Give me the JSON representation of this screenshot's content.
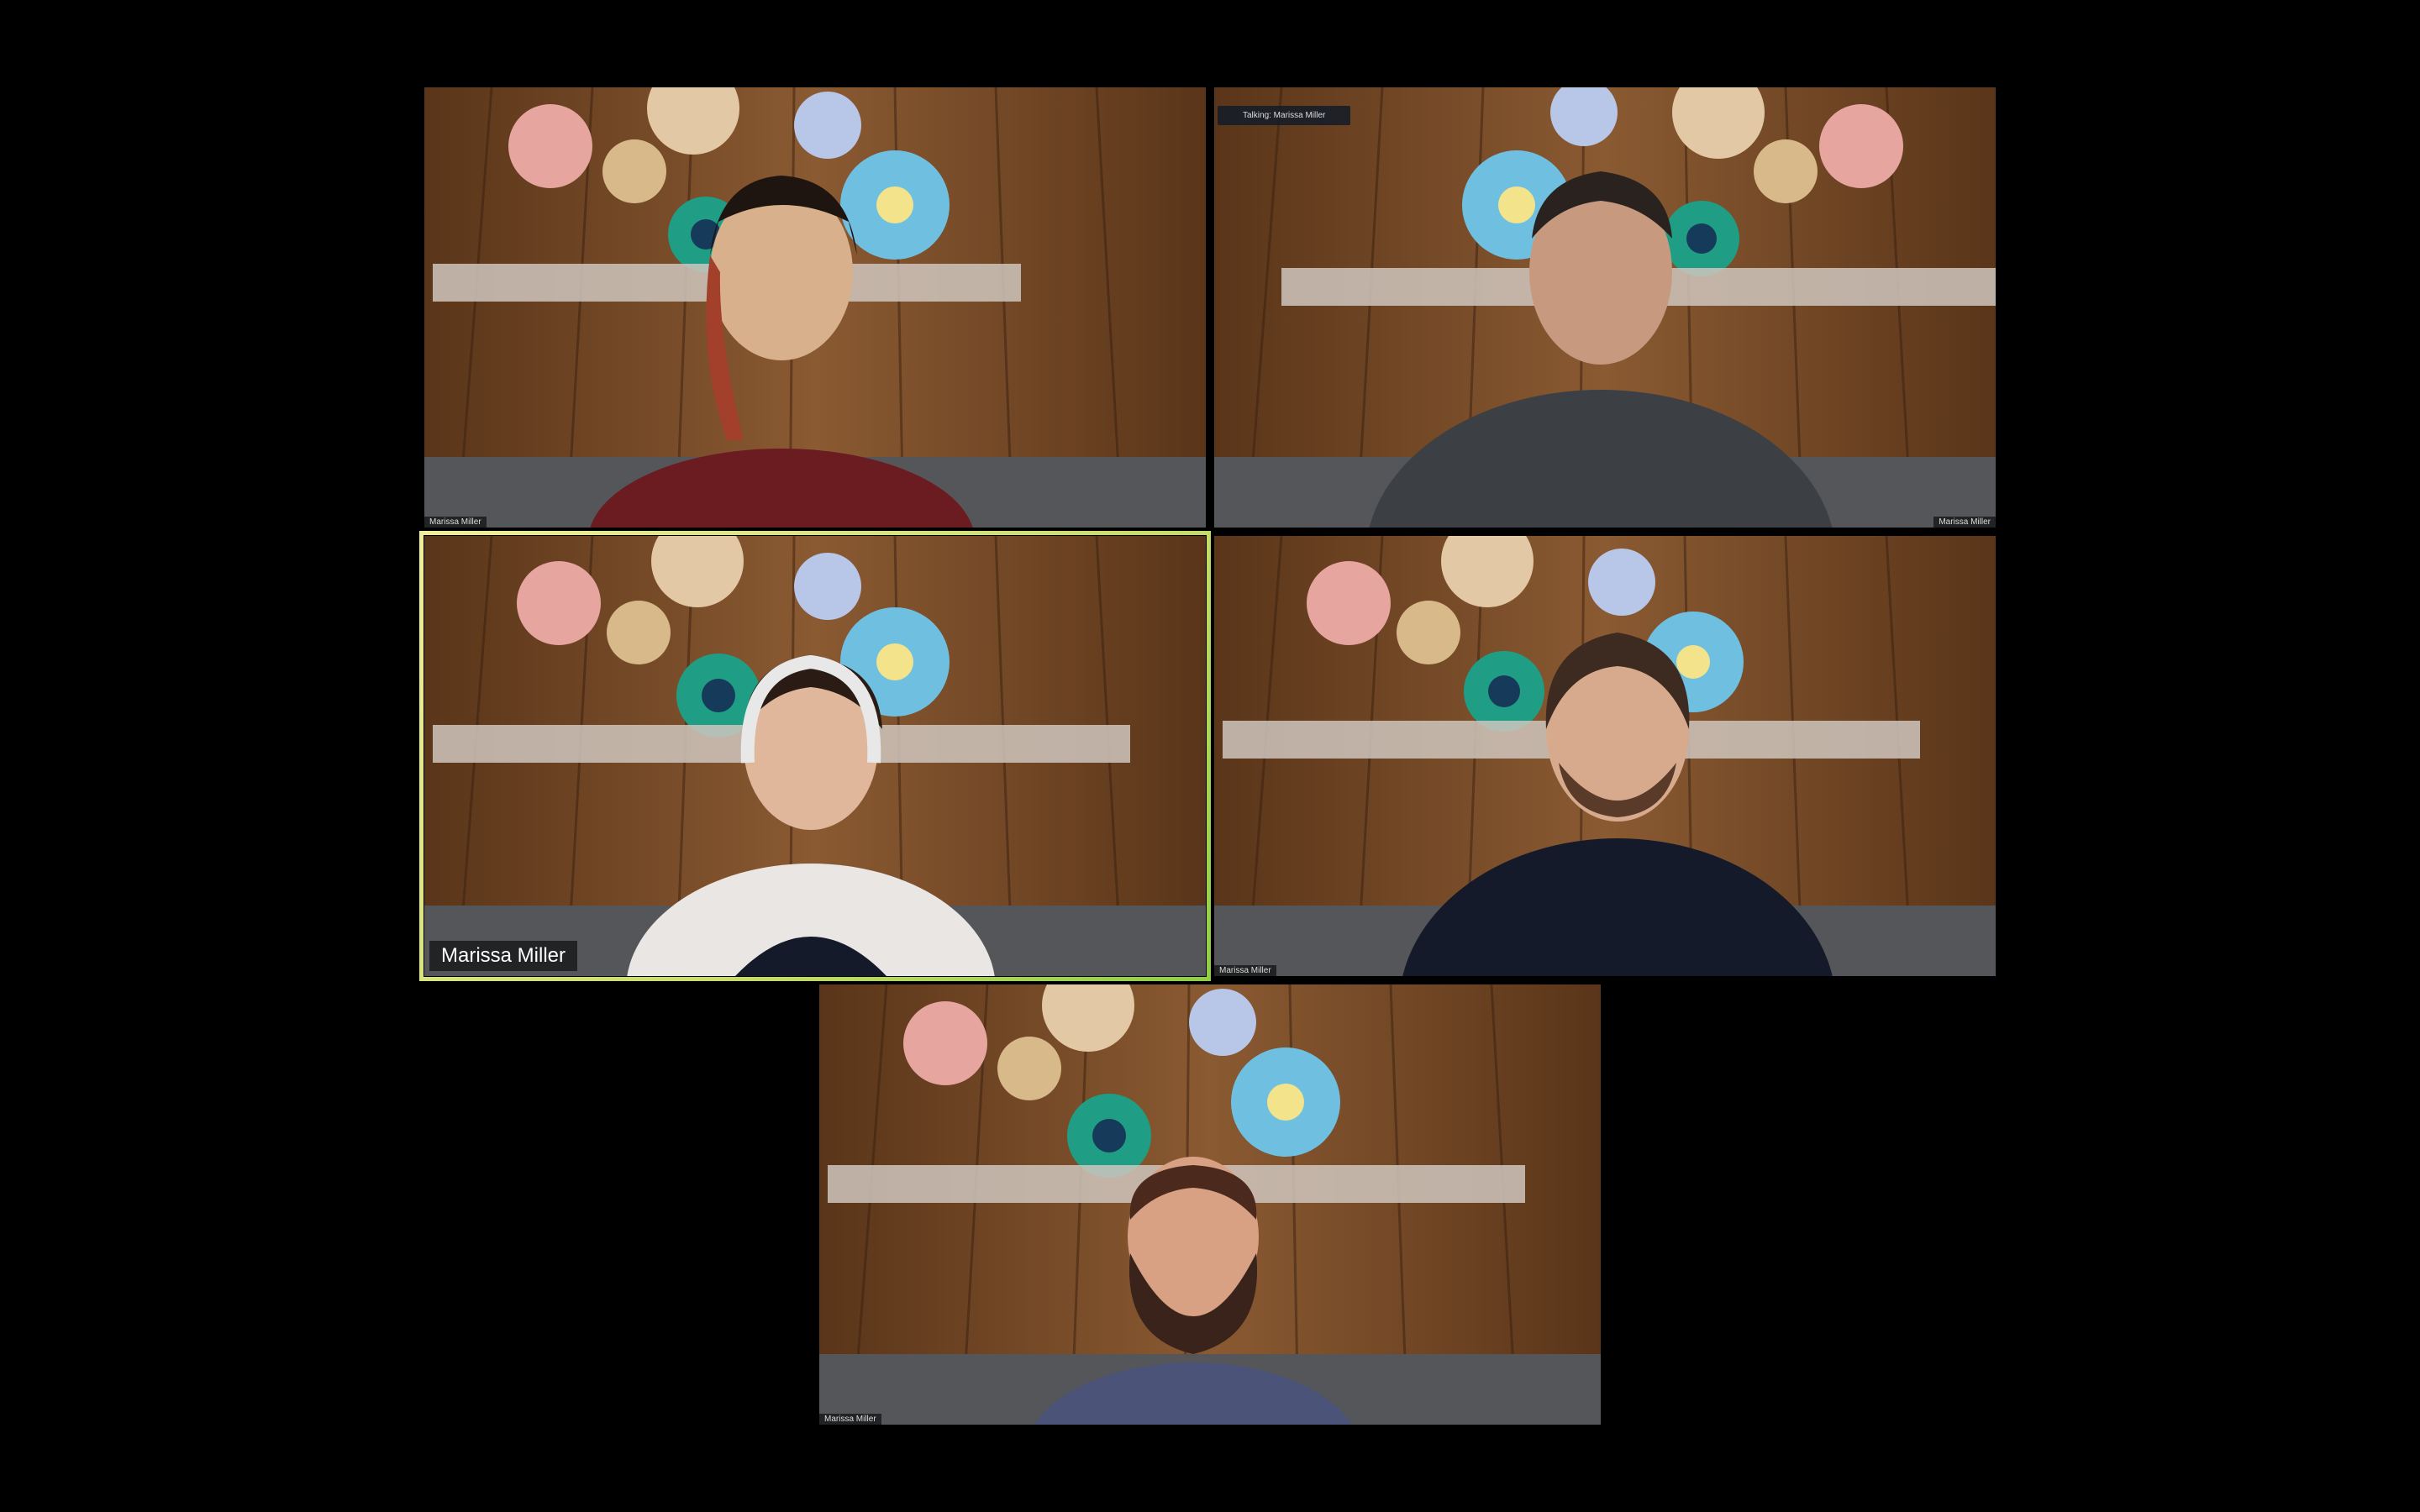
{
  "meeting": {
    "view": "gallery",
    "participants": [
      {
        "id": "p1",
        "label": "Marissa Miller",
        "label_style": "small",
        "active_speaker": false
      },
      {
        "id": "p2",
        "label": "Marissa Miller",
        "label_style": "small-right",
        "top_banner": "Talking: Marissa Miller",
        "active_speaker": false
      },
      {
        "id": "p3",
        "label": "Marissa Miller",
        "label_style": "large",
        "active_speaker": true
      },
      {
        "id": "p4",
        "label": "Marissa Miller",
        "label_style": "small",
        "active_speaker": false
      },
      {
        "id": "p5",
        "label": "Marissa Miller",
        "label_style": "small",
        "active_speaker": false
      }
    ]
  },
  "colors": {
    "background": "#000000",
    "active_speaker_border": "#c9dd6a",
    "wall": "#6b4426"
  }
}
